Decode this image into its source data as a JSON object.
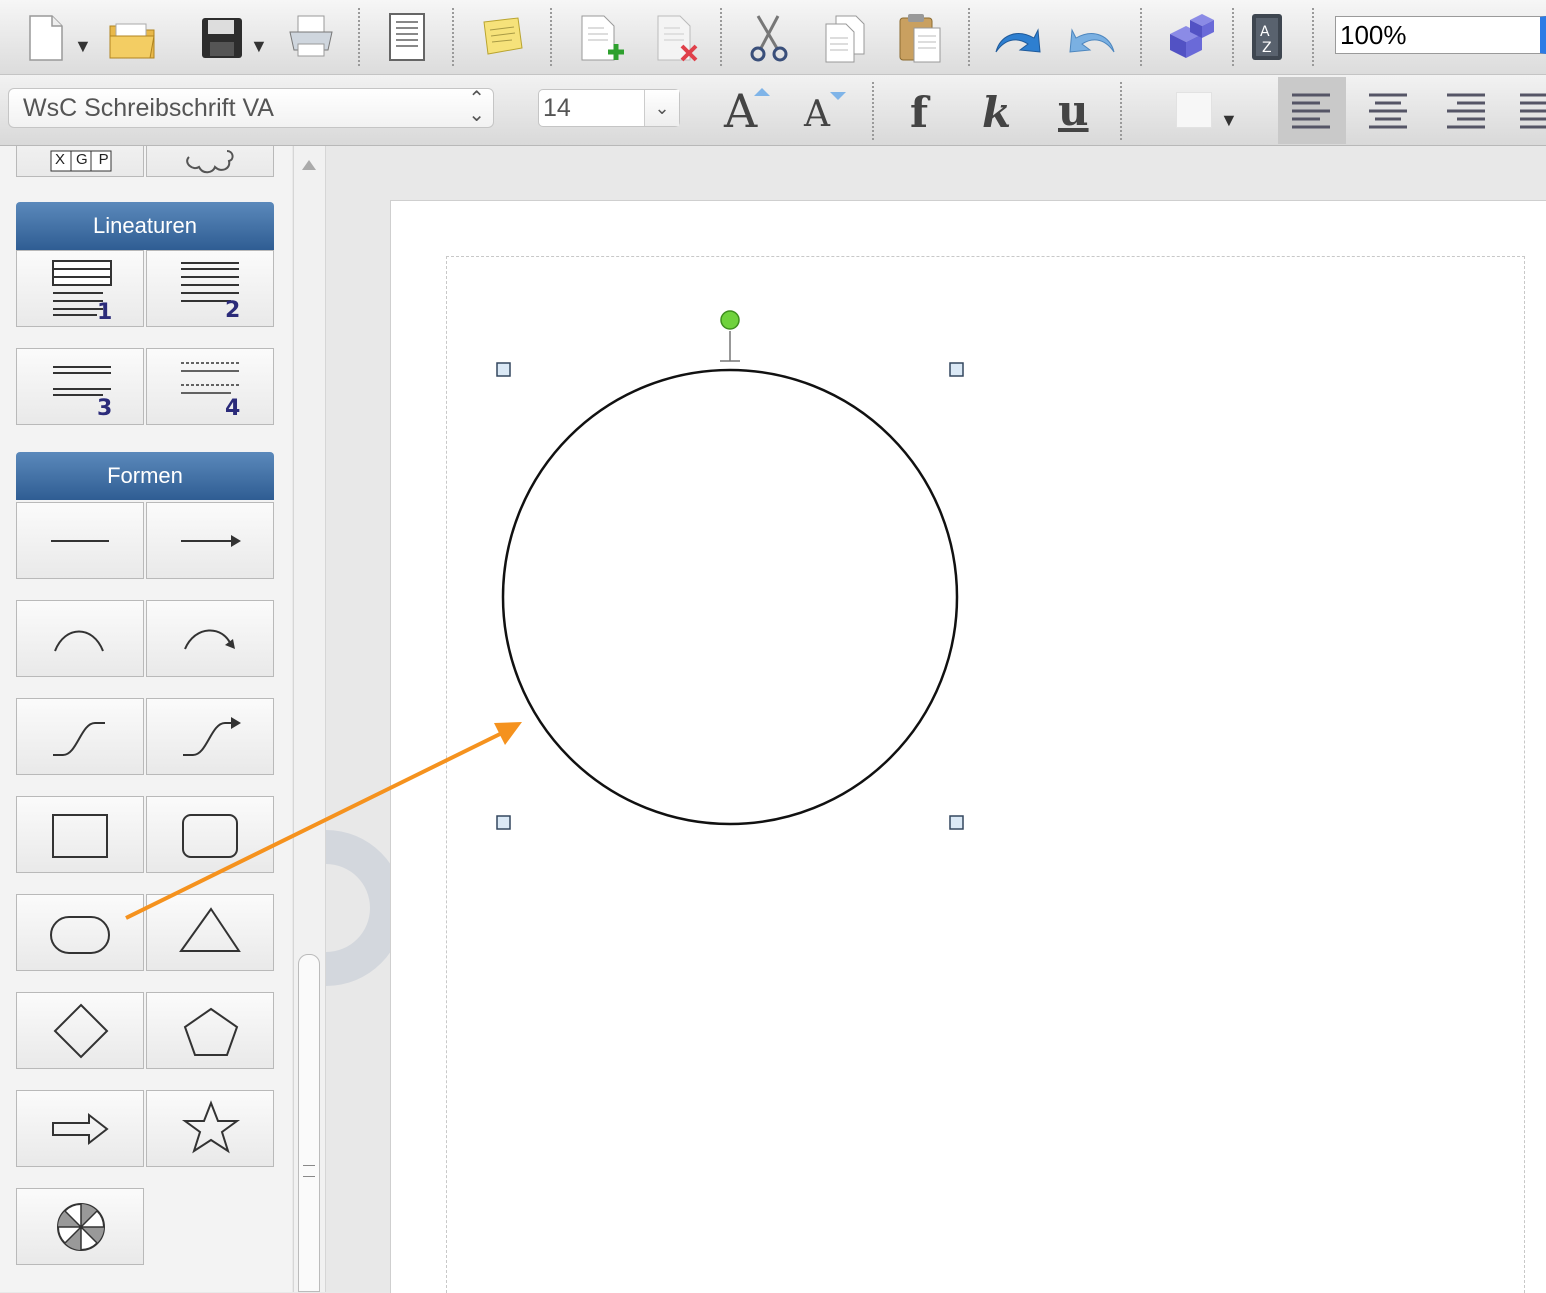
{
  "toolbar": {
    "zoom_value": "100%",
    "icons": [
      "new-document-icon",
      "open-folder-icon",
      "save-icon",
      "print-icon",
      "page-layout-icon",
      "note-icon",
      "add-page-icon",
      "delete-page-icon",
      "cut-icon",
      "copy-icon",
      "paste-icon",
      "undo-icon",
      "redo-icon",
      "dice-icon",
      "dictionary-icon"
    ]
  },
  "format_bar": {
    "font_name": "WsC Schreibschrift VA",
    "font_size": "14",
    "bold_label": "f",
    "italic_label": "k",
    "underline_label": "u",
    "grow_font_label": "A",
    "shrink_font_label": "A"
  },
  "sidebar": {
    "sections": [
      {
        "title": "Lineaturen",
        "items": [
          "1",
          "2",
          "3",
          "4"
        ]
      },
      {
        "title": "Formen",
        "items": [
          "line",
          "arrow-line",
          "arc",
          "arc-arrow",
          "s-curve",
          "s-curve-arrow",
          "rectangle",
          "rounded-rectangle",
          "ellipse",
          "triangle",
          "diamond",
          "pentagon",
          "block-arrow",
          "star",
          "segmented-circle"
        ]
      }
    ],
    "top_partial_label": "XGP"
  },
  "colors": {
    "accent_orange": "#f5921e",
    "section_header_blue": "#2f5d93",
    "handle_green": "#6fd23c"
  }
}
